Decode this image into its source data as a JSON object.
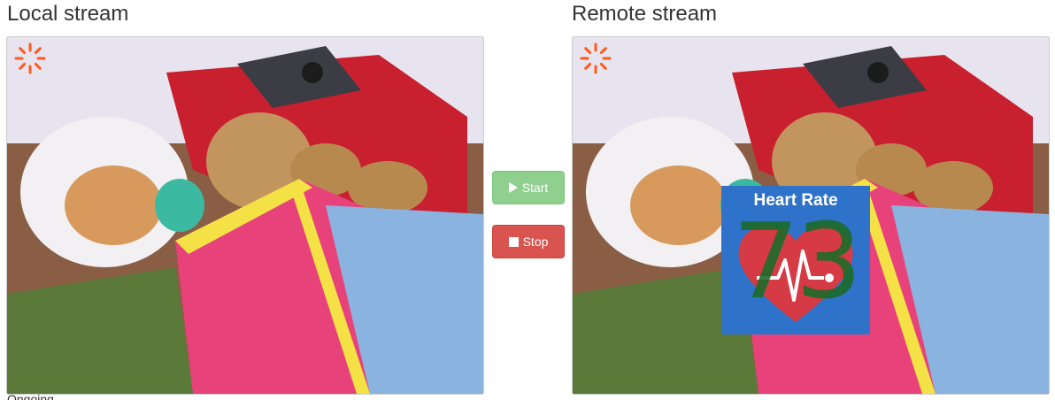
{
  "local": {
    "title": "Local stream"
  },
  "remote": {
    "title": "Remote stream",
    "overlay": {
      "label": "Heart Rate",
      "value": "73"
    }
  },
  "controls": {
    "start_label": "Start",
    "stop_label": "Stop"
  },
  "footer": {
    "text": "Ongoing"
  },
  "colors": {
    "start_button": "#8fd08f",
    "stop_button": "#d9534f",
    "overlay_background": "#2f72c9",
    "overlay_heart": "#d63a44",
    "overlay_number": "#1c6b2a"
  },
  "icons": {
    "start": "play-icon",
    "stop": "stop-icon",
    "spinner": "loading-spinner-icon",
    "heart": "heart-icon"
  }
}
